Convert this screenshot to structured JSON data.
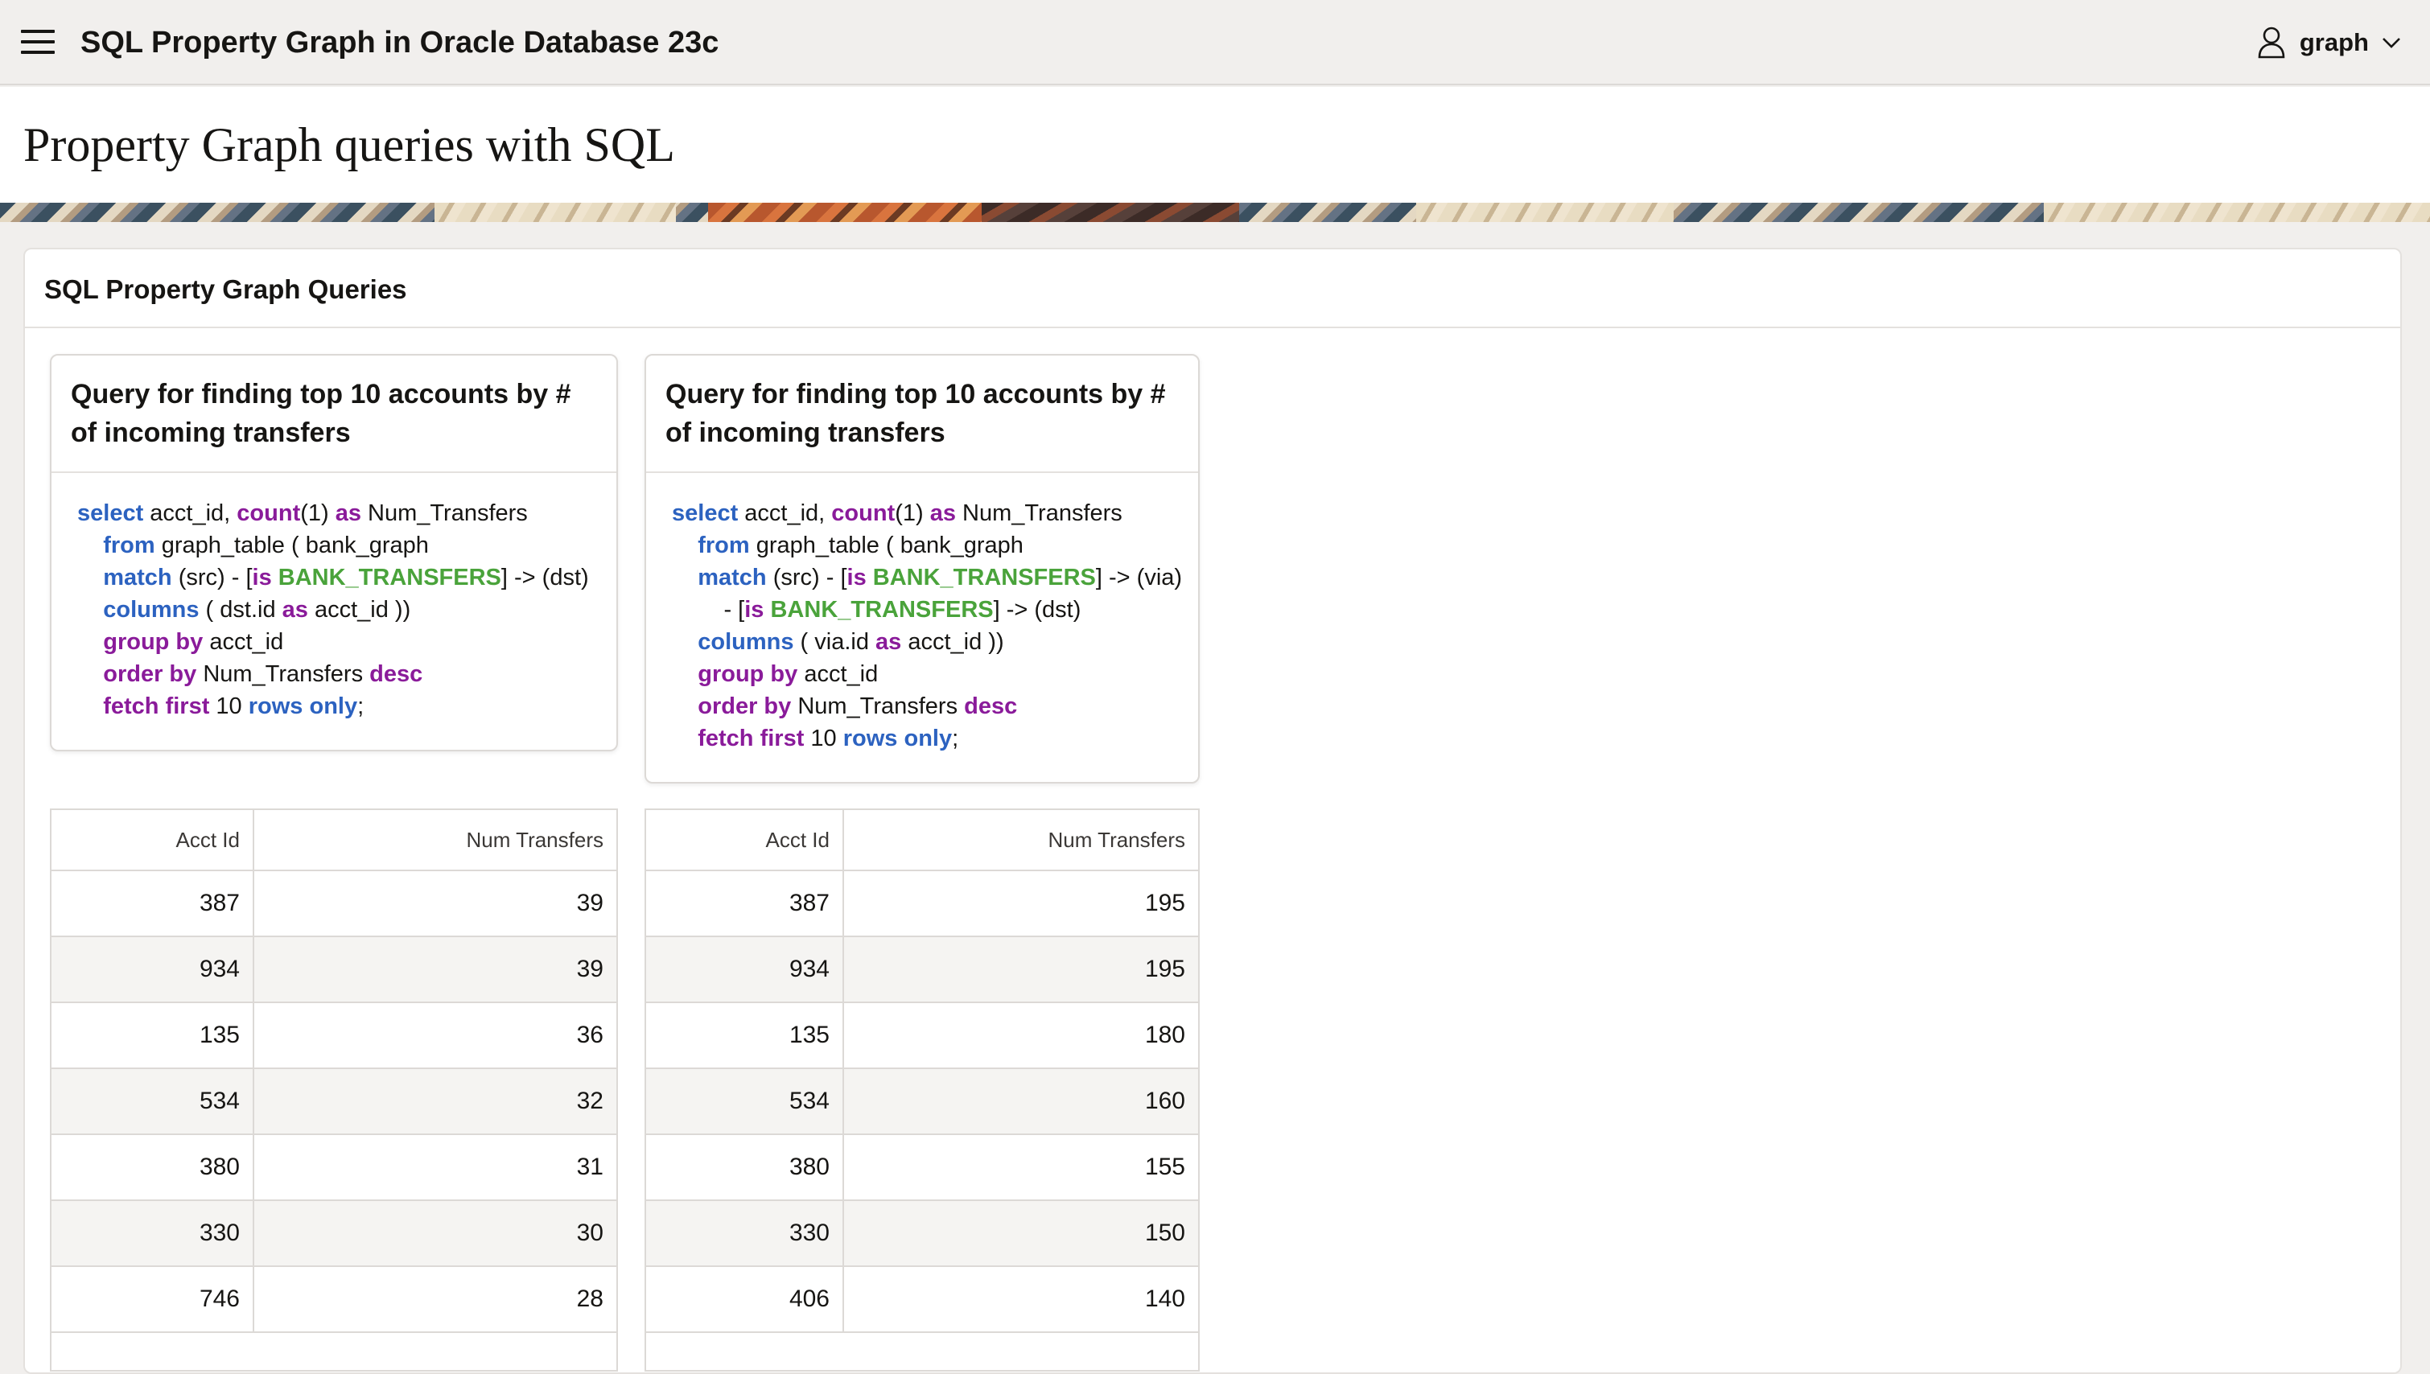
{
  "header": {
    "app_title": "SQL Property Graph in Oracle Database 23c",
    "user_name": "graph"
  },
  "hero": {
    "title": "Property Graph queries with SQL"
  },
  "region": {
    "title": "SQL Property Graph Queries"
  },
  "cards": [
    {
      "title": "Query for finding top 10 accounts by # of incoming transfers",
      "code_lines": [
        [
          [
            "kb",
            "select"
          ],
          [
            "t",
            " acct_id, "
          ],
          [
            "kp",
            "count"
          ],
          [
            "t",
            "(1) "
          ],
          [
            "kp",
            "as"
          ],
          [
            "t",
            " Num_Transfers"
          ]
        ],
        [
          [
            "t",
            "    "
          ],
          [
            "kb",
            "from"
          ],
          [
            "t",
            " graph_table ( bank_graph"
          ]
        ],
        [
          [
            "t",
            "    "
          ],
          [
            "kb",
            "match"
          ],
          [
            "t",
            " (src) - ["
          ],
          [
            "kp",
            "is"
          ],
          [
            "t",
            " "
          ],
          [
            "kg",
            "BANK_TRANSFERS"
          ],
          [
            "t",
            "] -> (dst)"
          ]
        ],
        [
          [
            "t",
            "    "
          ],
          [
            "kb",
            "columns"
          ],
          [
            "t",
            " ( dst.id "
          ],
          [
            "kp",
            "as"
          ],
          [
            "t",
            " acct_id ))"
          ]
        ],
        [
          [
            "t",
            "    "
          ],
          [
            "kp",
            "group by"
          ],
          [
            "t",
            " acct_id"
          ]
        ],
        [
          [
            "t",
            "    "
          ],
          [
            "kp",
            "order by"
          ],
          [
            "t",
            " Num_Transfers "
          ],
          [
            "kp",
            "desc"
          ]
        ],
        [
          [
            "t",
            "    "
          ],
          [
            "kp",
            "fetch first"
          ],
          [
            "t",
            " 10 "
          ],
          [
            "kb",
            "rows only"
          ],
          [
            "t",
            ";"
          ]
        ]
      ]
    },
    {
      "title": "Query for finding top 10 accounts by # of incoming transfers",
      "code_lines": [
        [
          [
            "kb",
            "select"
          ],
          [
            "t",
            " acct_id, "
          ],
          [
            "kp",
            "count"
          ],
          [
            "t",
            "(1) "
          ],
          [
            "kp",
            "as"
          ],
          [
            "t",
            " Num_Transfers"
          ]
        ],
        [
          [
            "t",
            "    "
          ],
          [
            "kb",
            "from"
          ],
          [
            "t",
            " graph_table ( bank_graph"
          ]
        ],
        [
          [
            "t",
            "    "
          ],
          [
            "kb",
            "match"
          ],
          [
            "t",
            " (src) - ["
          ],
          [
            "kp",
            "is"
          ],
          [
            "t",
            " "
          ],
          [
            "kg",
            "BANK_TRANSFERS"
          ],
          [
            "t",
            "] -> (via)"
          ]
        ],
        [
          [
            "t",
            "        - ["
          ],
          [
            "kp",
            "is"
          ],
          [
            "t",
            " "
          ],
          [
            "kg",
            "BANK_TRANSFERS"
          ],
          [
            "t",
            "] -> (dst)"
          ]
        ],
        [
          [
            "t",
            "    "
          ],
          [
            "kb",
            "columns"
          ],
          [
            "t",
            " ( via.id "
          ],
          [
            "kp",
            "as"
          ],
          [
            "t",
            " acct_id ))"
          ]
        ],
        [
          [
            "t",
            "    "
          ],
          [
            "kp",
            "group by"
          ],
          [
            "t",
            " acct_id"
          ]
        ],
        [
          [
            "t",
            "    "
          ],
          [
            "kp",
            "order by"
          ],
          [
            "t",
            " Num_Transfers "
          ],
          [
            "kp",
            "desc"
          ]
        ],
        [
          [
            "t",
            "    "
          ],
          [
            "kp",
            "fetch first"
          ],
          [
            "t",
            " 10 "
          ],
          [
            "kb",
            "rows only"
          ],
          [
            "t",
            ";"
          ]
        ]
      ]
    }
  ],
  "tables": [
    {
      "headers": [
        "Acct Id",
        "Num Transfers"
      ],
      "rows": [
        [
          "387",
          "39"
        ],
        [
          "934",
          "39"
        ],
        [
          "135",
          "36"
        ],
        [
          "534",
          "32"
        ],
        [
          "380",
          "31"
        ],
        [
          "330",
          "30"
        ],
        [
          "746",
          "28"
        ]
      ]
    },
    {
      "headers": [
        "Acct Id",
        "Num Transfers"
      ],
      "rows": [
        [
          "387",
          "195"
        ],
        [
          "934",
          "195"
        ],
        [
          "135",
          "180"
        ],
        [
          "534",
          "160"
        ],
        [
          "380",
          "155"
        ],
        [
          "330",
          "150"
        ],
        [
          "406",
          "140"
        ]
      ]
    }
  ],
  "colors": {
    "keyword_blue": "#2c62c0",
    "keyword_purple": "#8a1b9a",
    "keyword_green": "#4aa33b",
    "header_bg": "#f1efed"
  }
}
